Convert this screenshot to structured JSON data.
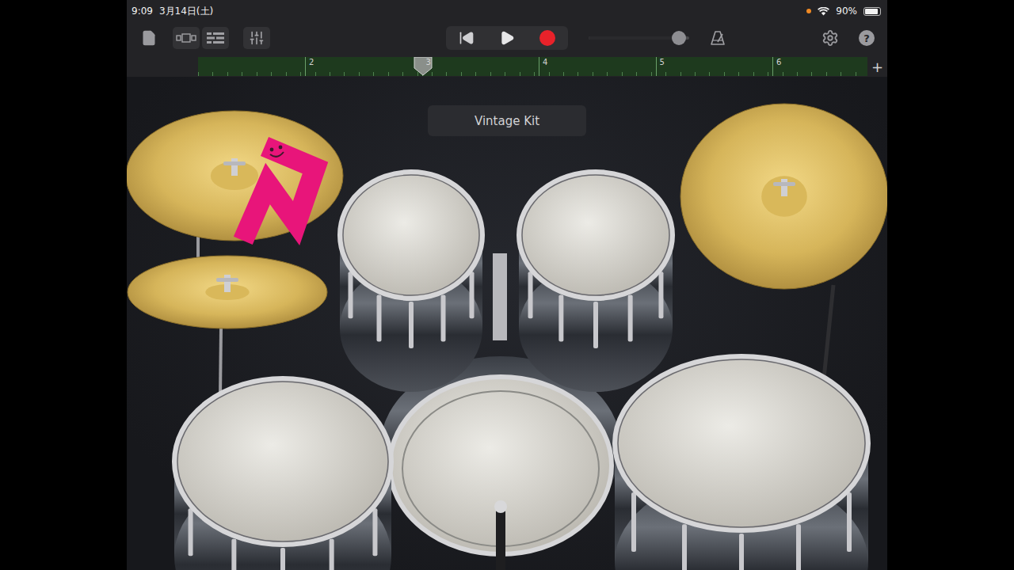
{
  "status_bar": {
    "time": "9:09",
    "date": "3月14日(土)",
    "battery": "90%",
    "battery_level": 0.9,
    "mic_in_use": true
  },
  "toolbar": {
    "volume": {
      "level": 0.9
    },
    "help": "?"
  },
  "ruler": {
    "bars": [
      {
        "label": "2",
        "playhead": false
      },
      {
        "label": "3",
        "playhead": true
      },
      {
        "label": "4",
        "playhead": false
      },
      {
        "label": "5",
        "playhead": false
      },
      {
        "label": "6",
        "playhead": false
      }
    ],
    "add": "+"
  },
  "kit": {
    "name": "Vintage Kit"
  }
}
